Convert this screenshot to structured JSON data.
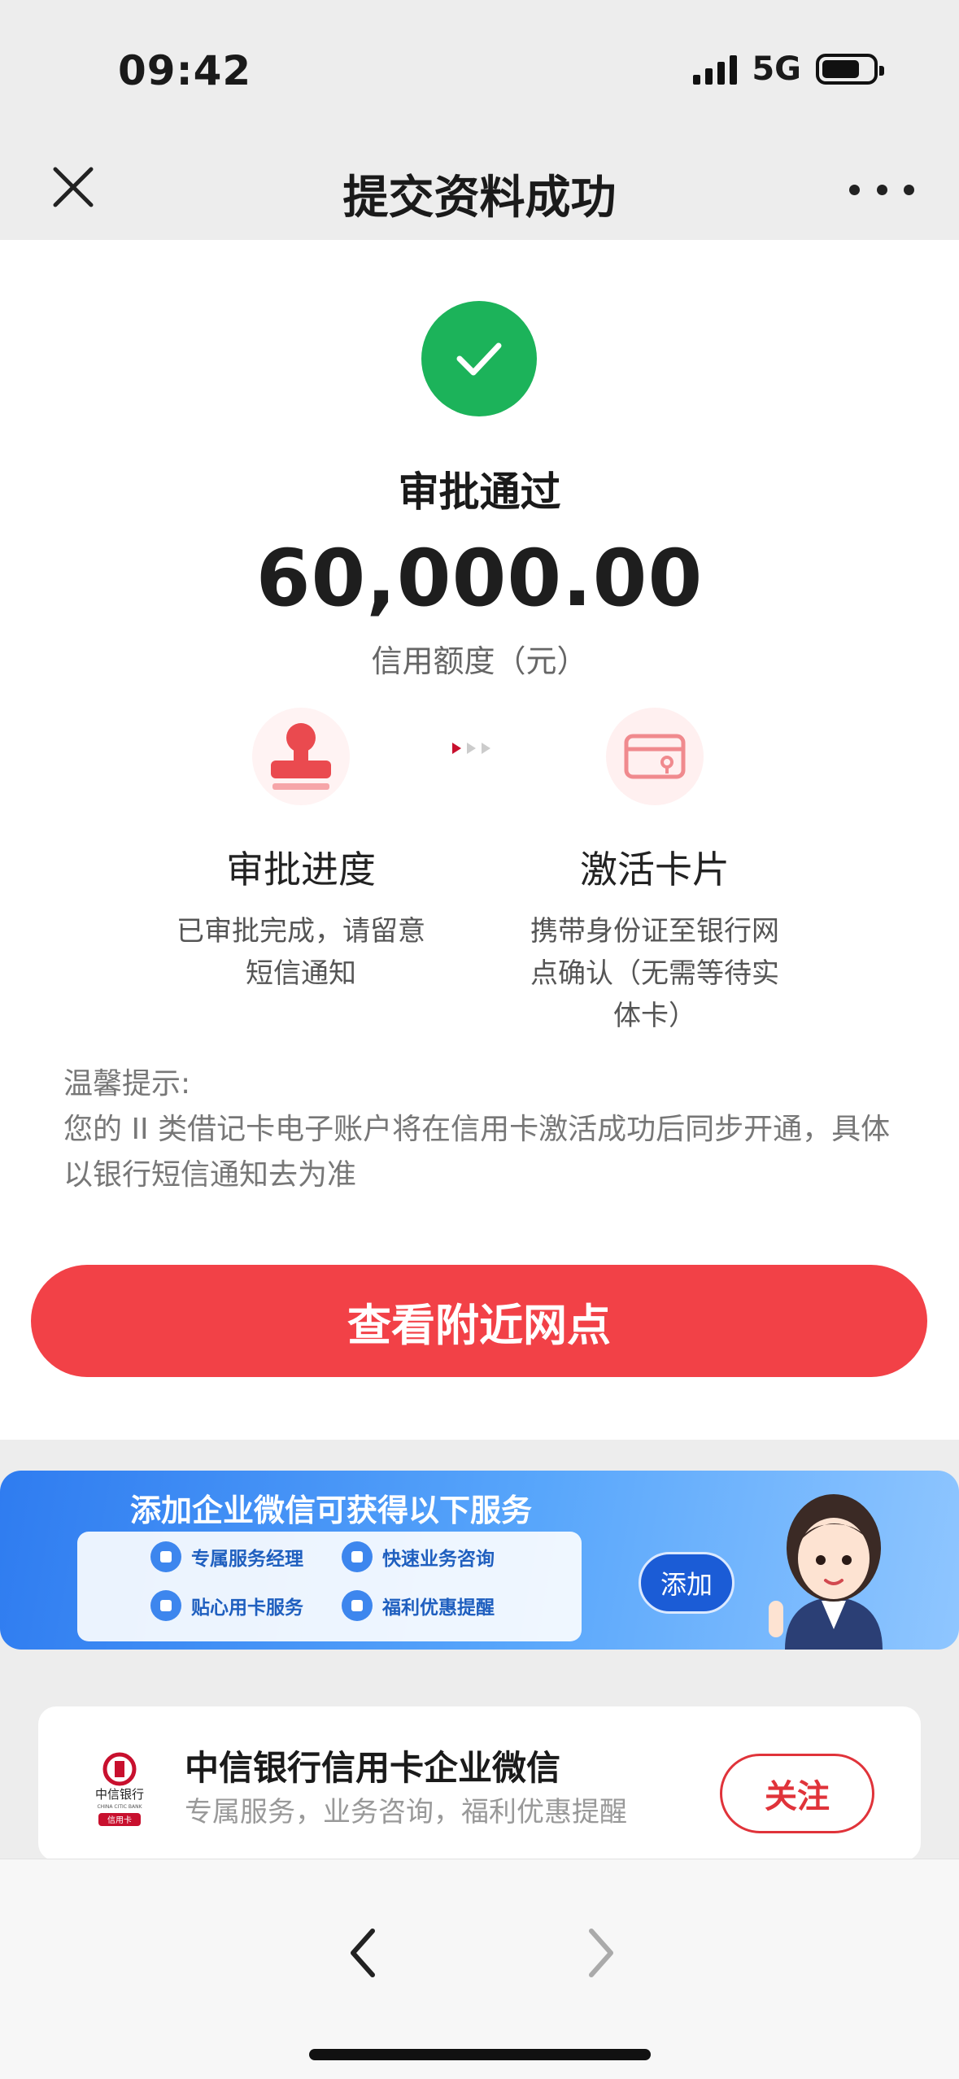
{
  "status_bar": {
    "time": "09:42",
    "network": "5G",
    "battery_level": 0.75
  },
  "nav": {
    "title": "提交资料成功",
    "close_icon": "close-icon",
    "more_icon": "more-icon"
  },
  "result": {
    "status": "审批通过",
    "amount": "60,000.00",
    "amount_label": "信用额度（元）",
    "check_color": "#1cb35a"
  },
  "steps": [
    {
      "title": "审批进度",
      "desc": "已审批完成，请留意短信通知",
      "icon": "stamp-icon"
    },
    {
      "title": "激活卡片",
      "desc": "携带身份证至银行网点确认（无需等待实体卡）",
      "icon": "card-icon"
    }
  ],
  "tips": {
    "heading": "温馨提示:",
    "body": "您的 II 类借记卡电子账户将在信用卡激活成功后同步开通，具体 以银行短信通知去为准"
  },
  "primary_button": {
    "label": "查看附近网点",
    "color": "#f24147"
  },
  "banner": {
    "title": "添加企业微信可获得以下服务",
    "services": [
      "专属服务经理",
      "快速业务咨询",
      "贴心用卡服务",
      "福利优惠提醒"
    ],
    "add_label": "添加"
  },
  "follow_card": {
    "name": "中信银行信用卡企业微信",
    "desc": "专属服务，业务咨询，福利优惠提醒",
    "button_label": "关注",
    "logo_text": "中信银行",
    "logo_subtext": "CHINA CITIC BANK",
    "logo_tag": "信用卡"
  },
  "bottom_nav": {
    "back_icon": "chevron-left-icon",
    "forward_icon": "chevron-right-icon"
  }
}
